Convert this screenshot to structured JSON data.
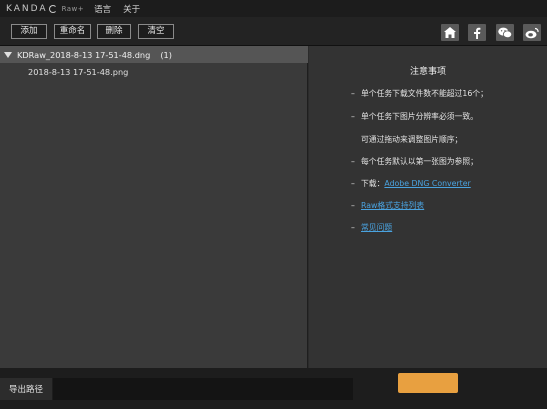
{
  "titlebar": {
    "brand": "KANDA",
    "brand_sub": "Raw+",
    "menu": [
      "语言",
      "关于"
    ]
  },
  "toolbar": {
    "add_label": "添加",
    "rename_label": "重命名",
    "delete_label": "删除",
    "clear_label": "清空",
    "social_icons": [
      "home-icon",
      "facebook-icon",
      "wechat-icon",
      "weibo-icon"
    ]
  },
  "file_list": {
    "group_name": "KDRaw_2018-8-13 17-51-48.dng",
    "group_count": "(1)",
    "files": [
      "2018-8-13 17-51-48.png"
    ]
  },
  "notes": {
    "title": "注意事项",
    "items": [
      "单个任务下载文件数不能超过16个；",
      "单个任务下图片分辨率必须一致。",
      "可通过拖动来调整图片顺序；",
      "每个任务默认以第一张图为参照；"
    ],
    "download_prefix": "下载：",
    "download_link": "Adobe DNG Converter",
    "format_link": "Raw格式支持列表",
    "faq_link": "常见问题"
  },
  "bottom": {
    "export_label": "导出路径",
    "export_path": ""
  },
  "colors": {
    "link": "#4aa3e0",
    "start_button": "#e8a040"
  }
}
